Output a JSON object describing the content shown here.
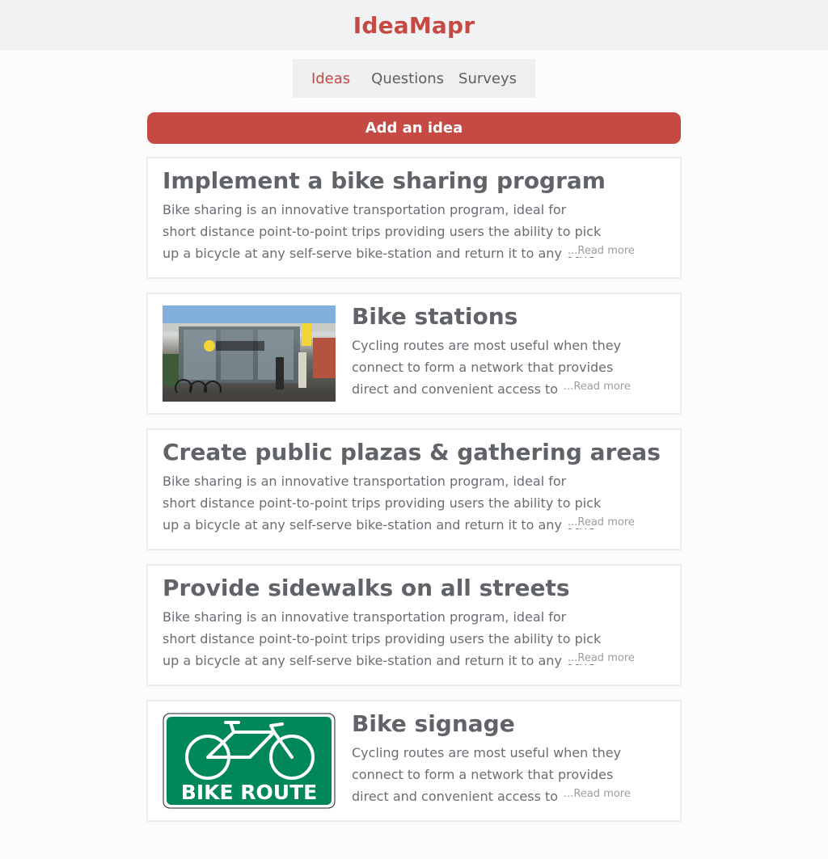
{
  "app": {
    "title": "IdeaMapr"
  },
  "tabs": [
    {
      "label": "Ideas",
      "active": true
    },
    {
      "label": "Questions",
      "active": false
    },
    {
      "label": "Surveys",
      "active": false
    }
  ],
  "actions": {
    "add_label": "Add an idea"
  },
  "ideas": [
    {
      "title": "Implement a bike sharing program",
      "description": "Bike sharing is an innovative transportation program, ideal for short distance point-to-point trips providing users the ability to pick up a bicycle at any self-serve bike-station and return it to any othe",
      "read_more": "...Read more",
      "image": null
    },
    {
      "title": "Bike stations",
      "description": "Cycling routes are most useful when they connect to form a network that provides direct and convenient access to",
      "read_more": "...Read more",
      "image": "bike-station-photo"
    },
    {
      "title": "Create public plazas & gathering areas",
      "description": "Bike sharing is an innovative transportation program, ideal for short distance point-to-point trips providing users the ability to pick up a bicycle at any self-serve bike-station and return it to any othe",
      "read_more": "...Read more",
      "image": null
    },
    {
      "title": "Provide sidewalks on all streets",
      "description": "Bike sharing is an innovative transportation program, ideal for short distance point-to-point trips providing users the ability to pick up a bicycle at any self-serve bike-station and return it to any othe",
      "read_more": "...Read more",
      "image": null
    },
    {
      "title": "Bike signage",
      "description": "Cycling routes are most useful when they connect to form a network that provides direct and convenient access to",
      "read_more": "...Read more",
      "image": "bike-route-sign",
      "image_text": "BIKE ROUTE"
    }
  ],
  "colors": {
    "accent": "#c54a43",
    "text": "#606368",
    "sign_green": "#00875a"
  }
}
